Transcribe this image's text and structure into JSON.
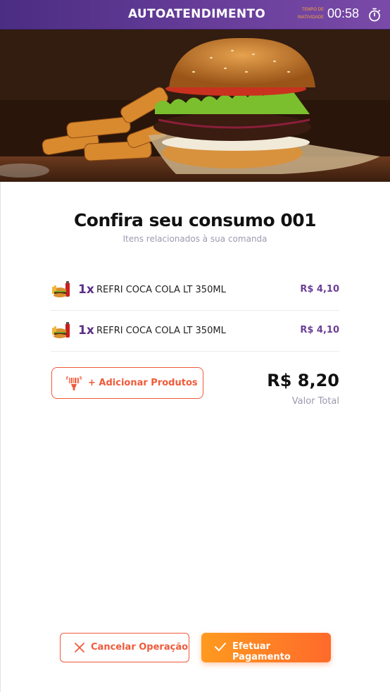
{
  "header": {
    "title": "AUTOATENDIMENTO",
    "inactivity_label_line1": "TEMPO DE",
    "inactivity_label_line2": "INATIVIDADE",
    "timer": "00:58",
    "timer_icon": "stopwatch-icon"
  },
  "hero": {
    "image": "burger-and-fries-photo"
  },
  "summary": {
    "title": "Confira seu consumo 001",
    "subtitle": "Itens relacionados à sua comanda"
  },
  "items": [
    {
      "icon": "combo-meal-icon",
      "qty": "1x",
      "name": "REFRI COCA COLA LT 350ML",
      "price": "R$ 4,10"
    },
    {
      "icon": "combo-meal-icon",
      "qty": "1x",
      "name": "REFRI COCA COLA LT 350ML",
      "price": "R$ 4,10"
    }
  ],
  "add_products": {
    "label": "+ Adicionar Produtos",
    "icon": "barcode-scanner-icon"
  },
  "total": {
    "value": "R$ 8,20",
    "label": "Valor Total"
  },
  "actions": {
    "cancel_label": "Cancelar Operação",
    "pay_label": "Efetuar Pagamento"
  },
  "colors": {
    "header_purple": "#5b3590",
    "accent_orange": "#f05a3a",
    "button_gradient_start": "#ff9a1f",
    "button_gradient_end": "#ff6a2b",
    "price_purple": "#6b3f95"
  }
}
